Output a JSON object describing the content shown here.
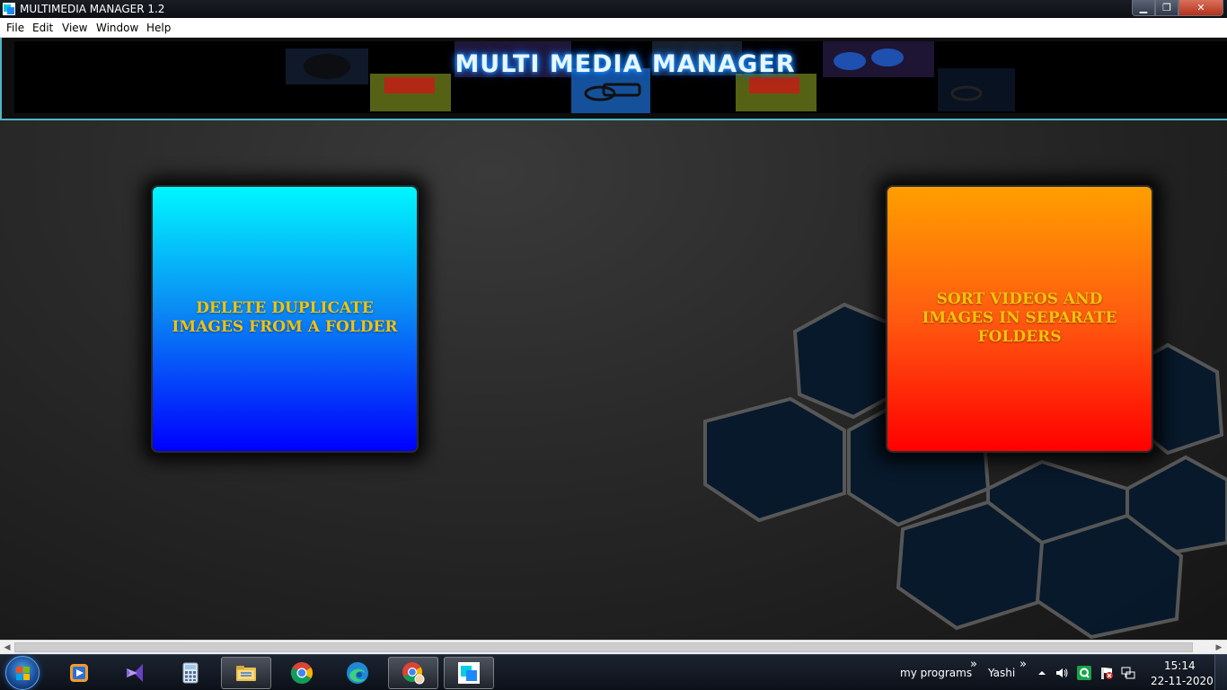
{
  "window": {
    "title": "MULTIMEDIA MANAGER 1.2",
    "controls": {
      "minimize": "▁",
      "maximize": "❐",
      "close": "✕"
    }
  },
  "menu": {
    "items": [
      {
        "label": "File"
      },
      {
        "label": "Edit"
      },
      {
        "label": "View"
      },
      {
        "label": "Window"
      },
      {
        "label": "Help"
      }
    ]
  },
  "banner": {
    "title": "MULTI MEDIA MANAGER"
  },
  "cards": {
    "delete": {
      "label": "DELETE DUPLICATE IMAGES FROM A FOLDER"
    },
    "sort": {
      "label": "SORT VIDEOS AND IMAGES IN SEPARATE FOLDERS"
    }
  },
  "colors": {
    "label_gold": "#f2c20d",
    "card_blue_top": "#00f7ff",
    "card_blue_bottom": "#0000ff",
    "card_orange_top": "#ff9f00",
    "card_orange_bottom": "#ff0000",
    "banner_glow": "#27a3ff"
  },
  "taskbar": {
    "apps": [
      {
        "name": "windows-media-player-icon"
      },
      {
        "name": "visual-studio-icon"
      },
      {
        "name": "calculator-icon"
      },
      {
        "name": "file-explorer-icon"
      },
      {
        "name": "chrome-icon"
      },
      {
        "name": "edge-icon"
      },
      {
        "name": "chrome-profile-icon"
      },
      {
        "name": "multimedia-manager-icon"
      }
    ],
    "toolbars": [
      {
        "label": "my programs",
        "chevron": "»"
      },
      {
        "label": "Yashi",
        "chevron": "»"
      }
    ],
    "clock": {
      "time": "15:14",
      "date": "22-11-2020"
    },
    "scroll_arrows": {
      "left": "◀",
      "right": "▶"
    }
  }
}
